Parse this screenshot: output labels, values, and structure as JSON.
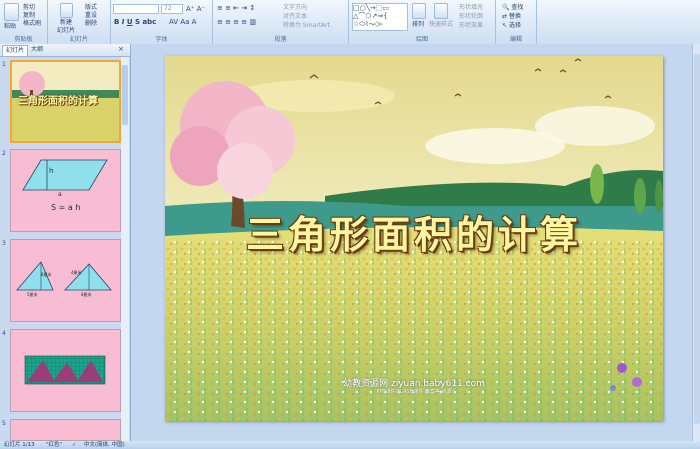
{
  "ribbon": {
    "groups": [
      "剪贴板",
      "幻灯片",
      "字体",
      "段落",
      "绘图",
      "编辑"
    ],
    "clipboard": {
      "paste": "粘贴",
      "cut": "剪切",
      "copy": "复制",
      "format_painter": "格式刷"
    },
    "slides": {
      "new_slide": "新建",
      "new_slide_2": "幻灯片",
      "layout": "版式",
      "reset": "重设",
      "delete": "删除"
    },
    "font": {
      "size": "72"
    },
    "paragraph": {
      "text_direction": "文字方向",
      "align_text": "对齐文本",
      "smartart": "转换为 SmartArt"
    },
    "drawing": {
      "arrange": "排列",
      "quick_styles": "快速样式",
      "shape_fill": "形状填充",
      "shape_outline": "形状轮廓",
      "shape_effects": "形状效果"
    },
    "editing": {
      "find": "查找",
      "replace": "替换",
      "select": "选择"
    }
  },
  "pane": {
    "tabs": [
      "幻灯片",
      "大纲"
    ],
    "thumbnails": [
      {
        "number": "1",
        "title": "三角形面积的计算"
      },
      {
        "number": "2",
        "label_h": "h",
        "label_a": "a",
        "formula": "S = a h"
      },
      {
        "number": "3",
        "label_left": "8厘米",
        "label_right": "4厘米",
        "label_b1": "5厘米",
        "label_b2": "8厘米"
      },
      {
        "number": "4"
      },
      {
        "number": "5"
      }
    ]
  },
  "slide": {
    "title": "三角形面积的计算",
    "watermark": "幼教资源网 ziyuan.baby611.com",
    "watermark_sub": "PPT课件 FLASH课件 教案等 资源"
  },
  "status": {
    "slide_counter": "幻灯片 1/13",
    "theme": "\"红色\"",
    "language": "中文(简体, 中国)"
  },
  "colors": {
    "ribbon_top": "#f3f8fd",
    "title_fill": "#fff7a0",
    "title_stroke": "#6b3b12",
    "thumb_bg": "#f8bdd3",
    "selected_border": "#f2a637"
  }
}
